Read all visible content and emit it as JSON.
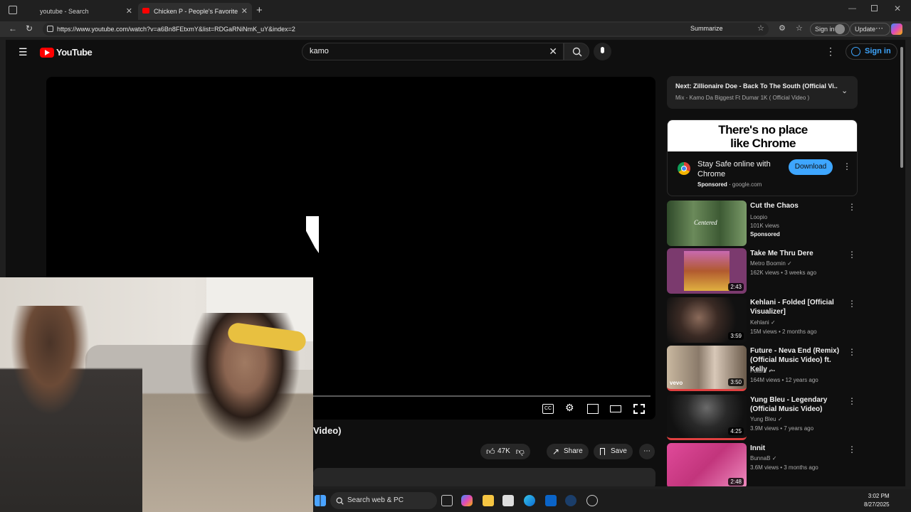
{
  "browser": {
    "tabs": [
      {
        "title": "youtube - Search",
        "active": false
      },
      {
        "title": "Chicken P - People's Favorite (Re",
        "active": true
      }
    ],
    "url": "https://www.youtube.com/watch?v=a6Bn8FEtxmY&list=RDGaRNiNmK_uY&index=2",
    "summarize_label": "Summarize",
    "signin_label": "Sign in",
    "update_label": "Update"
  },
  "youtube": {
    "logo_text": "YouTube",
    "search_query": "kamo",
    "signin_label": "Sign in",
    "video_title_fragment": "Video)",
    "actions": {
      "likes": "47K",
      "share": "Share",
      "save": "Save"
    }
  },
  "next_up": {
    "label": "Next:",
    "title": "Zillionaire Doe - Back To The South (Official Vi...",
    "subtitle": "Mix - Kamo Da Biggest Ft Dumar 1K ( Official Video )"
  },
  "ad": {
    "banner_line1": "There's no place",
    "banner_line2": "like Chrome",
    "headline": "Stay Safe online with Chrome",
    "sponsored": "Sponsored",
    "domain": "google.com",
    "button": "Download"
  },
  "recommendations": [
    {
      "title": "Cut the Chaos",
      "channel": "Loopio",
      "meta": "101K views",
      "extra": "Sponsored",
      "duration": "",
      "thumb_text": "Centered",
      "thumb_color": "#4d6a3f"
    },
    {
      "title": "Take Me Thru Dere",
      "channel": "Metro Boomin",
      "meta": "162K views • 3 weeks ago",
      "extra": "",
      "duration": "2:43",
      "thumb_text": "",
      "thumb_color": "#7b3a6e"
    },
    {
      "title": "Kehlani - Folded [Official Visualizer]",
      "channel": "Kehlani",
      "meta": "15M views • 2 months ago",
      "extra": "",
      "duration": "3:59",
      "thumb_text": "",
      "thumb_color": "#2a2a2a"
    },
    {
      "title": "Future - Neva End (Remix) (Official Music Video) ft. Kelly ...",
      "channel": "Future",
      "meta": "164M views • 12 years ago",
      "extra": "",
      "duration": "3:50",
      "thumb_text": "vevo",
      "thumb_color": "#8a7a6a"
    },
    {
      "title": "Yung Bleu - Legendary (Official Music Video)",
      "channel": "Yung Bleu",
      "meta": "3.9M views • 7 years ago",
      "extra": "",
      "duration": "4:25",
      "thumb_text": "",
      "thumb_color": "#3a3a3a"
    },
    {
      "title": "Innit",
      "channel": "BunnaB",
      "meta": "3.6M views • 3 months ago",
      "extra": "",
      "duration": "2:48",
      "thumb_text": "",
      "thumb_color": "#c2357c"
    }
  ],
  "taskbar": {
    "search_placeholder": "Search web & PC",
    "time": "3:02 PM",
    "date": "8/27/2025"
  }
}
